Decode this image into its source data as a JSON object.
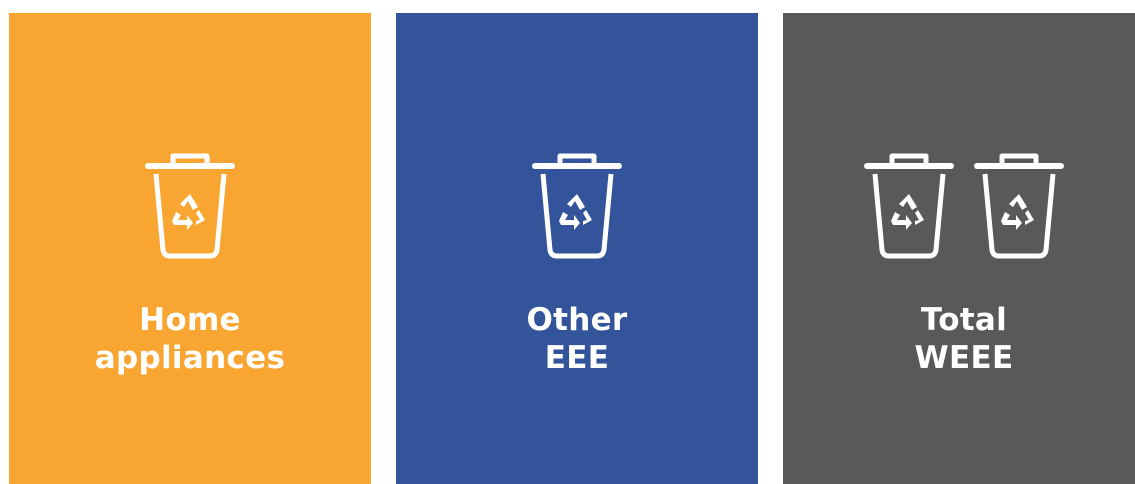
{
  "panels": [
    {
      "label_line1": "Home",
      "label_line2": "appliances",
      "bg_color": "#f8a631",
      "icons": [
        "recycle-bin-icon"
      ]
    },
    {
      "label_line1": "Other",
      "label_line2": "EEE",
      "bg_color": "#33549b",
      "icons": [
        "recycle-bin-icon"
      ]
    },
    {
      "label_line1": "Total",
      "label_line2": "WEEE",
      "bg_color": "#59595b",
      "icons": [
        "recycle-bin-icon",
        "recycle-bin-icon"
      ]
    }
  ],
  "icon_color": "#ffffff"
}
